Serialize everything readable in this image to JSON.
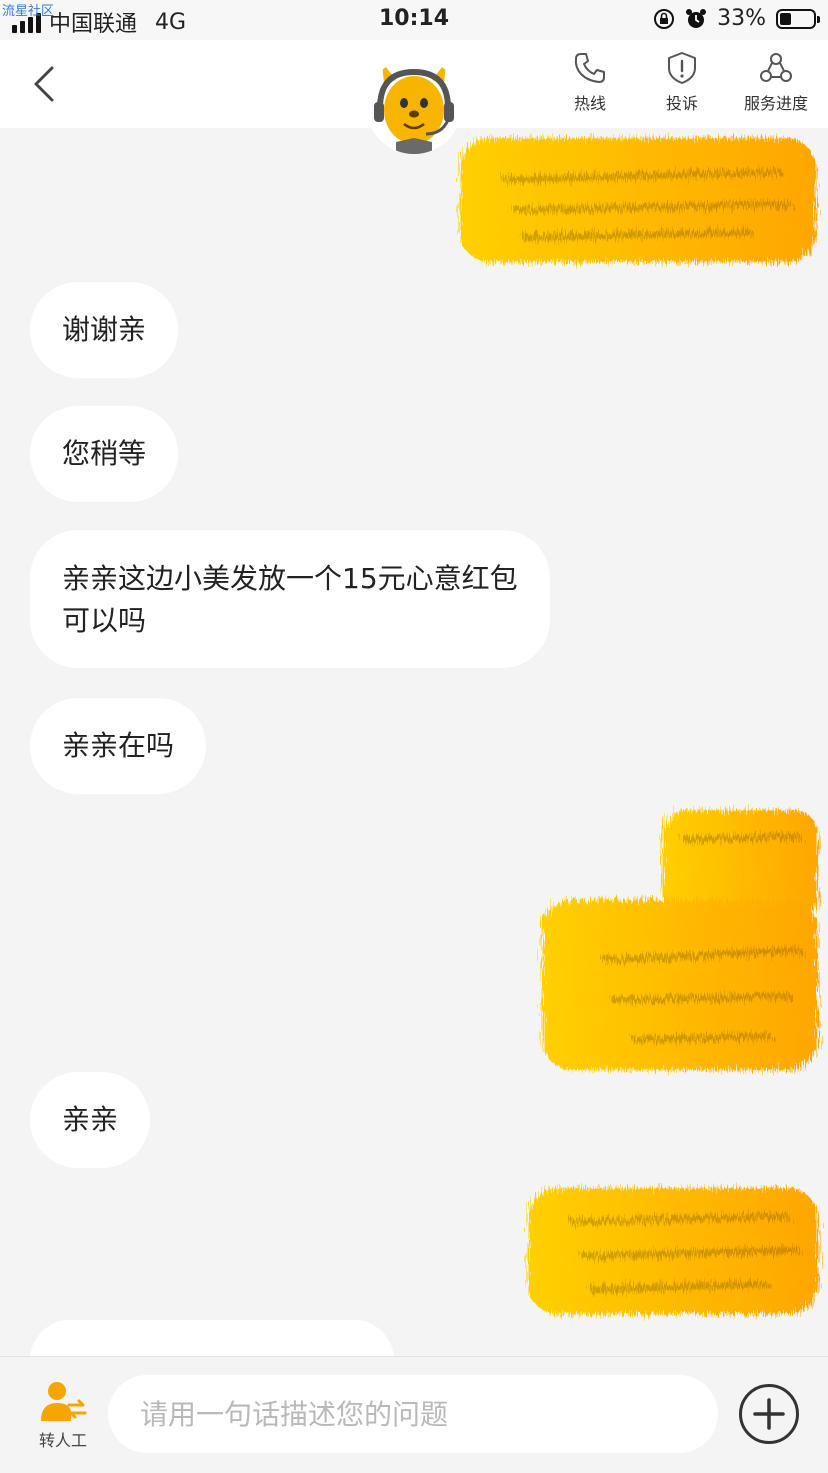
{
  "watermark": "流星社区",
  "status_bar": {
    "carrier": "中国联通",
    "network": "4G",
    "time": "10:14",
    "battery_percent": "33%",
    "battery_level": 0.33
  },
  "header": {
    "actions": [
      {
        "label": "热线",
        "icon": "phone-icon"
      },
      {
        "label": "投诉",
        "icon": "shield-alert-icon"
      },
      {
        "label": "服务进度",
        "icon": "progress-nodes-icon"
      }
    ]
  },
  "messages": [
    {
      "side": "right",
      "text": ""
    },
    {
      "side": "left",
      "text": "谢谢亲"
    },
    {
      "side": "left",
      "text": "您稍等"
    },
    {
      "side": "left",
      "lines": [
        "亲亲这边小美发放一个15元心意红包",
        "可以吗"
      ]
    },
    {
      "side": "left",
      "text": "亲亲在吗"
    },
    {
      "side": "right",
      "text": ""
    },
    {
      "side": "left",
      "text": "亲亲"
    },
    {
      "side": "right",
      "text": ""
    },
    {
      "side": "left",
      "text": ""
    }
  ],
  "input_bar": {
    "transfer_label": "转人工",
    "placeholder": "请用一句话描述您的问题"
  },
  "colors": {
    "accent": "#f7b500",
    "page_bg": "#f4f4f4",
    "bubble_bg": "#ffffff"
  }
}
